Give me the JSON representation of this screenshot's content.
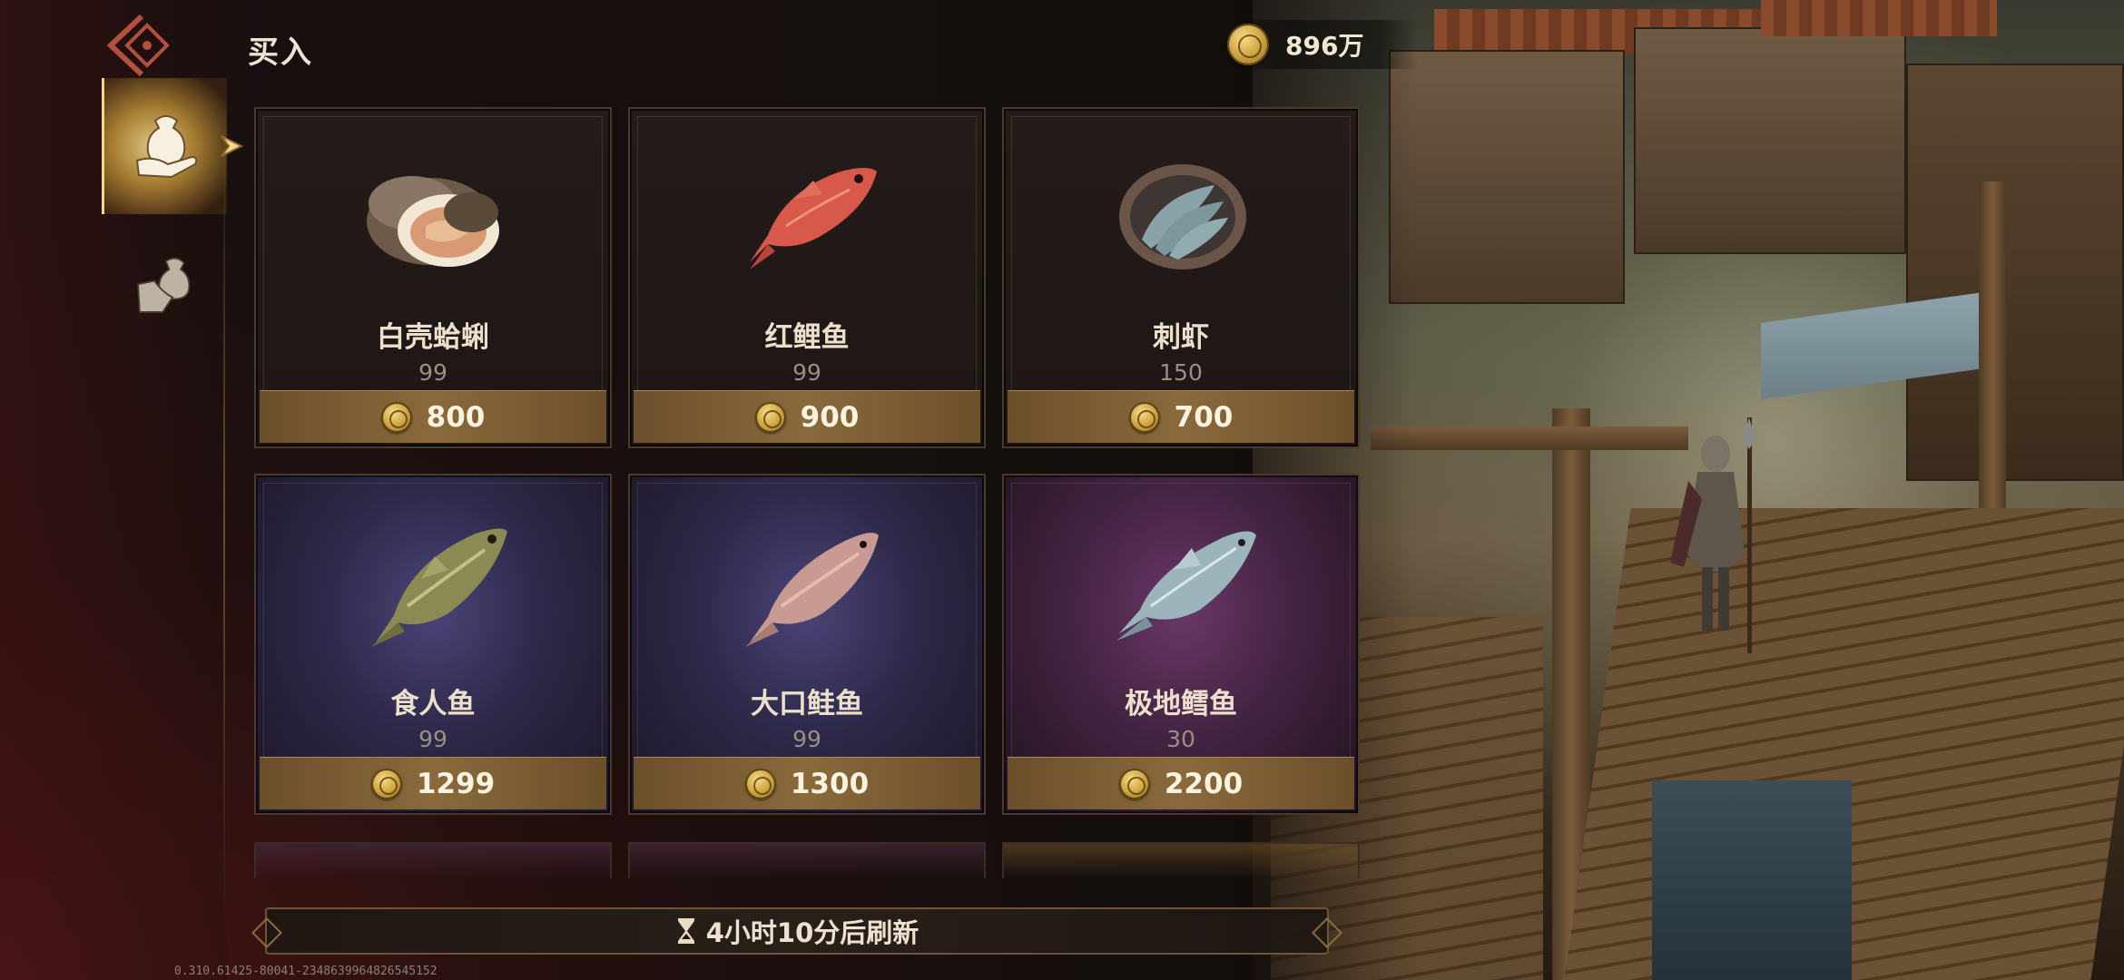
{
  "header": {
    "title": "买入",
    "currency_value": "896万"
  },
  "side_tabs": [
    {
      "name": "buy-tab",
      "active": true
    },
    {
      "name": "sell-tab",
      "active": false
    }
  ],
  "items": [
    {
      "name": "白壳蛤蜊",
      "stock": "99",
      "price": "800",
      "icon": "clam-icon",
      "rarity_color": "#241c1a"
    },
    {
      "name": "红鲤鱼",
      "stock": "99",
      "price": "900",
      "icon": "red-snapper-icon",
      "rarity_color": "#241c1a"
    },
    {
      "name": "刺虾",
      "stock": "150",
      "price": "700",
      "icon": "shrimp-icon",
      "rarity_color": "#241c1a"
    },
    {
      "name": "食人鱼",
      "stock": "99",
      "price": "1299",
      "icon": "bass-fish-icon",
      "rarity_color": "#4a4478"
    },
    {
      "name": "大口鲑鱼",
      "stock": "99",
      "price": "1300",
      "icon": "trout-icon",
      "rarity_color": "#4a4478"
    },
    {
      "name": "极地鳕鱼",
      "stock": "30",
      "price": "2200",
      "icon": "cod-icon",
      "rarity_color": "#6a3768"
    }
  ],
  "refresh": {
    "text": "4小时10分后刷新",
    "icon": "hourglass-icon"
  },
  "version": "0.310.61425-80041-2348639964826545152"
}
